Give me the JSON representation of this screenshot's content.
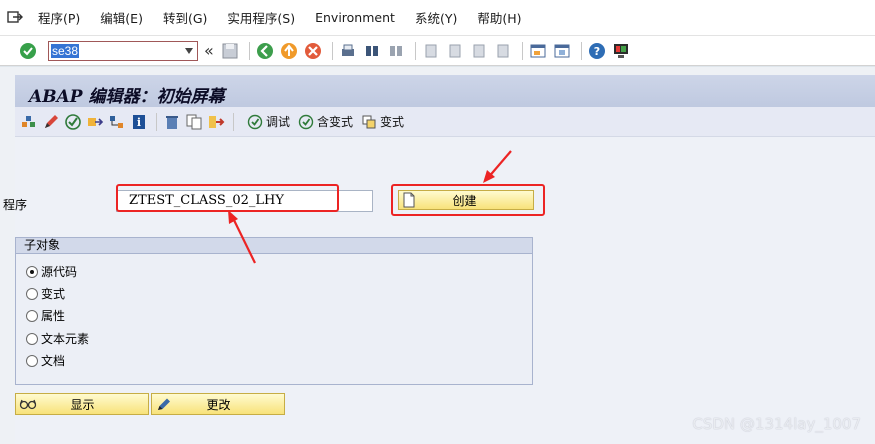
{
  "menu": [
    "程序(P)",
    "编辑(E)",
    "转到(G)",
    "实用程序(S)",
    "Environment",
    "系统(Y)",
    "帮助(H)"
  ],
  "toolbar": {
    "command_value": "se38"
  },
  "screen": {
    "title": "ABAP 编辑器：初始屏幕"
  },
  "app_toolbar": {
    "debug_label": "调试",
    "with_variant_label": "含变式",
    "variant_label": "变式"
  },
  "form": {
    "program_label": "程序",
    "program_value": "ZTEST_CLASS_02_LHY",
    "create_label": "创建"
  },
  "subobjects": {
    "title": "子对象",
    "options": [
      "源代码",
      "变式",
      "属性",
      "文本元素",
      "文档"
    ],
    "selected": 0
  },
  "buttons": {
    "display_label": "显示",
    "change_label": "更改"
  },
  "watermark": "CSDN @1314lay_1007",
  "colors": {
    "highlight": "#ec2424",
    "button": "#f8e27a",
    "title_bar": "#c6cfe4"
  }
}
